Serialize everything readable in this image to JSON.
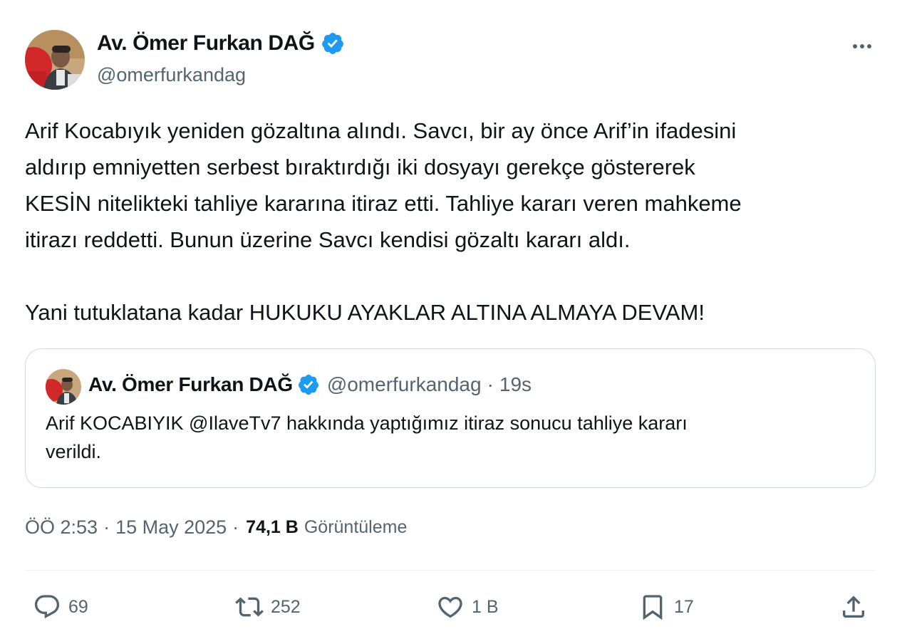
{
  "author": {
    "name": "Av. Ömer Furkan DAĞ",
    "handle": "@omerfurkandag"
  },
  "tweet": {
    "lines_p1": [
      "Arif Kocabıyık yeniden gözaltına alındı. Savcı, bir ay önce Arif’in ifadesini",
      "aldırıp emniyetten serbest bıraktırdığı iki dosyayı gerekçe göstererek",
      "KESİN nitelikteki tahliye kararına itiraz etti. Tahliye kararı veren mahkeme",
      "itirazı reddetti. Bunun üzerine Savcı kendisi gözaltı kararı aldı."
    ],
    "line_p2": "Yani tutuklatana kadar HUKUKU AYAKLAR ALTINA ALMAYA DEVAM!"
  },
  "quoted": {
    "name": "Av. Ömer Furkan DAĞ",
    "handle": "@omerfurkandag",
    "separator": "·",
    "time": "19s",
    "lines": [
      "Arif KOCABIYIK @IlaveTv7 hakkında yaptığımız itiraz sonucu tahliye kararı",
      "verildi."
    ]
  },
  "meta": {
    "time": "ÖÖ 2:53",
    "separator1": "·",
    "date": "15 May 2025",
    "separator2": "·",
    "views_count": "74,1 B",
    "views_label": "Görüntüleme"
  },
  "actions": {
    "replies": "69",
    "reposts": "252",
    "likes": "1 B",
    "bookmarks": "17"
  },
  "icons": {
    "more": "more-horizontal-icon",
    "verified": "verified-badge-icon",
    "reply": "reply-icon",
    "repost": "repost-icon",
    "like": "heart-icon",
    "bookmark": "bookmark-icon",
    "share": "share-icon"
  },
  "colors": {
    "verified": "#1d9bf0",
    "text": "#0f1419",
    "secondary": "#536471",
    "border": "#cfd9de"
  }
}
